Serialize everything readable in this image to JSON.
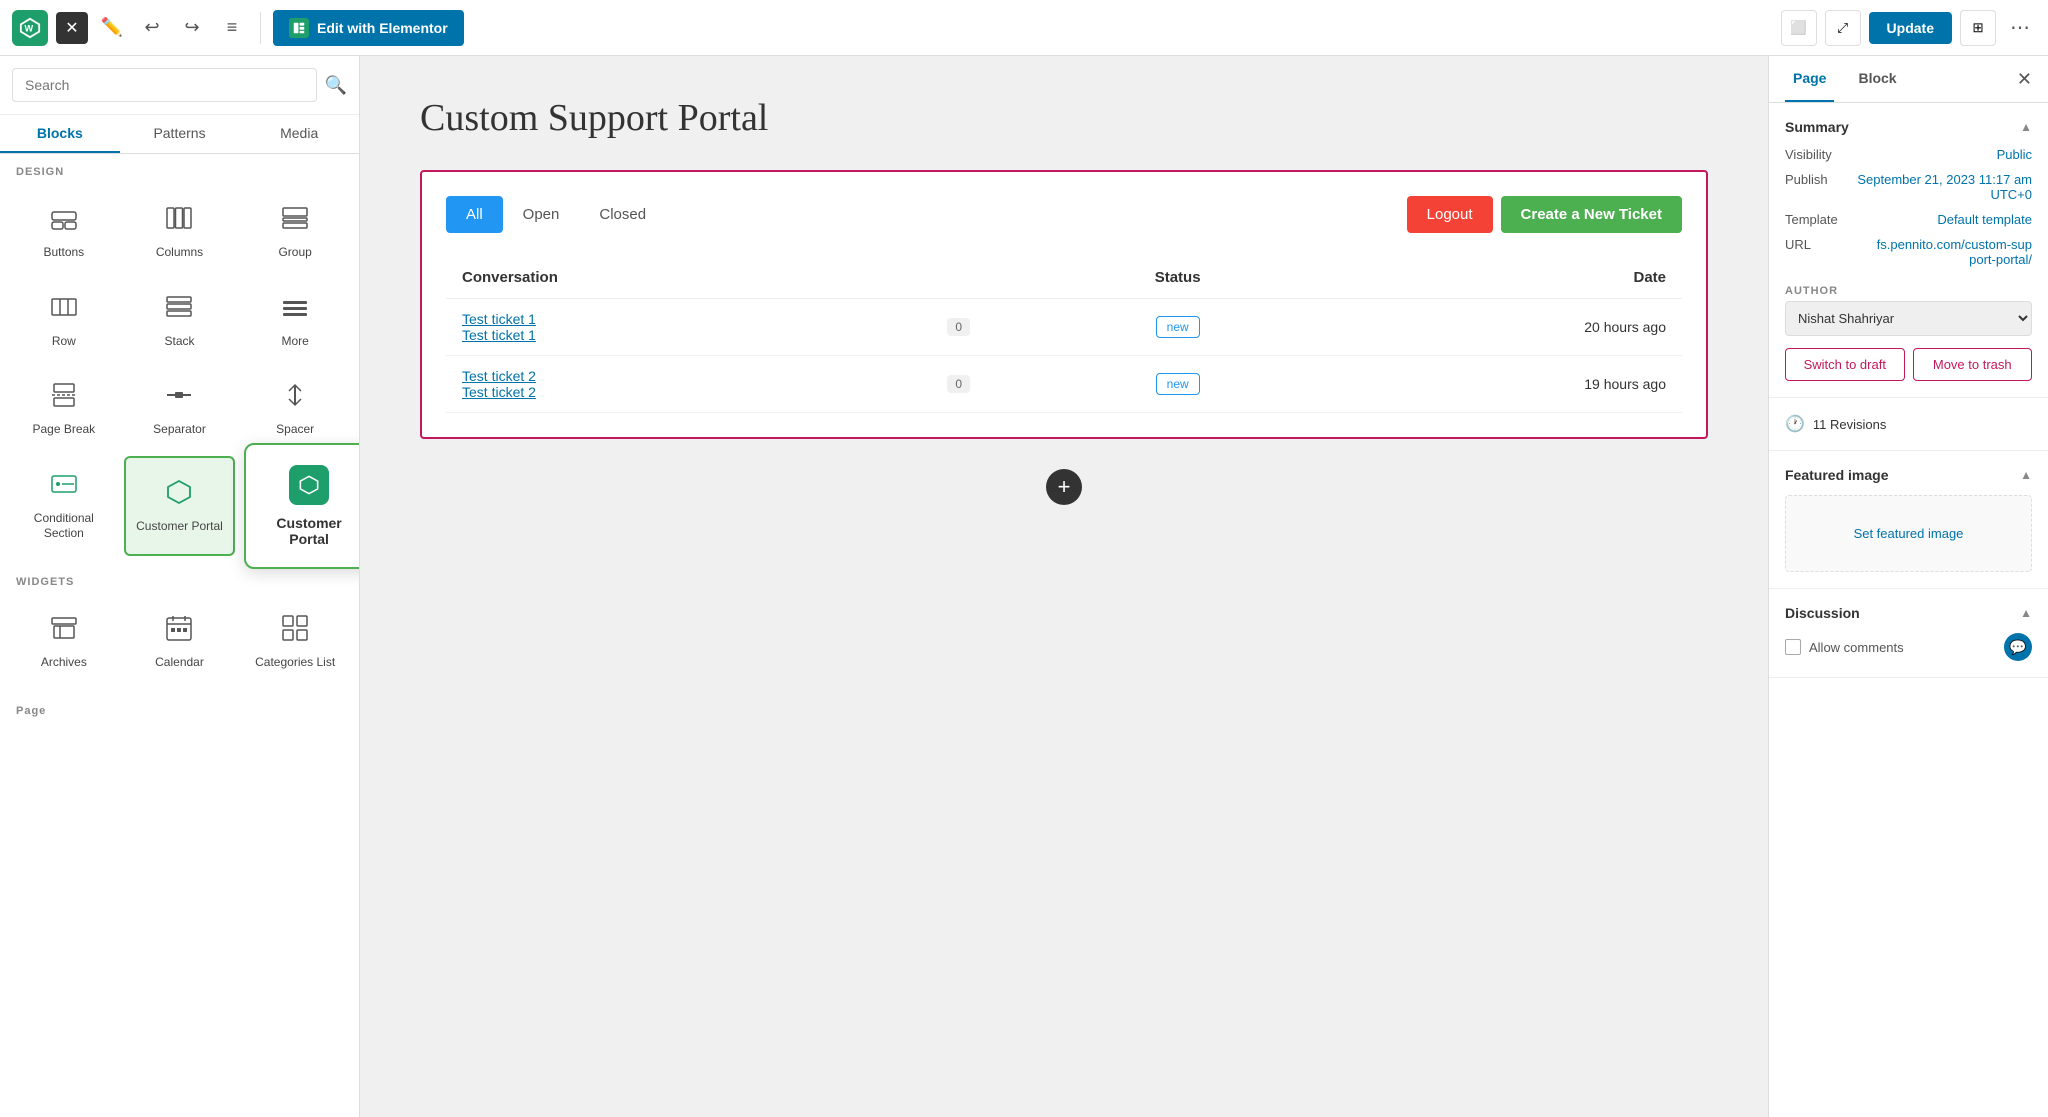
{
  "toolbar": {
    "edit_label": "Edit with Elementor",
    "update_label": "Update",
    "close_btn": "✕",
    "dots_label": "⋯"
  },
  "sidebar": {
    "search_placeholder": "Search",
    "tabs": [
      {
        "label": "Blocks",
        "active": true
      },
      {
        "label": "Patterns"
      },
      {
        "label": "Media"
      }
    ],
    "sections": [
      {
        "label": "DESIGN",
        "items": [
          {
            "icon": "⊞",
            "label": "Buttons"
          },
          {
            "icon": "⊟",
            "label": "Columns"
          },
          {
            "icon": "⊠",
            "label": "Group"
          },
          {
            "icon": "≡",
            "label": "Row"
          },
          {
            "icon": "⊡",
            "label": "Stack"
          },
          {
            "icon": "⋯",
            "label": "More"
          },
          {
            "icon": "⊟",
            "label": "Page Break"
          },
          {
            "icon": "—",
            "label": "Separator"
          },
          {
            "icon": "↗",
            "label": "Spacer"
          },
          {
            "icon": "⊞",
            "label": "Conditional Section",
            "highlighted": false
          },
          {
            "icon": "🟢",
            "label": "Customer Portal",
            "highlighted": true
          }
        ]
      },
      {
        "label": "WIDGETS",
        "items": [
          {
            "icon": "📁",
            "label": "Archives"
          },
          {
            "icon": "📅",
            "label": "Calendar"
          },
          {
            "icon": "⊞",
            "label": "Categories List"
          }
        ]
      }
    ],
    "page_label": "Page"
  },
  "canvas": {
    "page_title": "Custom Support Portal",
    "portal": {
      "tabs": [
        {
          "label": "All",
          "active": true
        },
        {
          "label": "Open"
        },
        {
          "label": "Closed"
        }
      ],
      "logout_label": "Logout",
      "new_ticket_label": "Create a New Ticket",
      "table": {
        "headers": [
          "Conversation",
          "",
          "Status",
          "Date"
        ],
        "rows": [
          {
            "link1": "Test ticket 1",
            "link2": "Test ticket 1",
            "count": "0",
            "status": "new",
            "date": "20 hours ago"
          },
          {
            "link1": "Test ticket 2",
            "link2": "Test ticket 2",
            "count": "0",
            "status": "new",
            "date": "19 hours ago"
          }
        ]
      }
    }
  },
  "right_panel": {
    "tabs": [
      {
        "label": "Page",
        "active": true
      },
      {
        "label": "Block"
      }
    ],
    "summary_label": "Summary",
    "visibility_label": "Visibility",
    "visibility_value": "Public",
    "publish_label": "Publish",
    "publish_value": "September 21, 2023 11:17 am UTC+0",
    "template_label": "Template",
    "template_value": "Default template",
    "url_label": "URL",
    "url_value": "fs.pennito.com/custom-support-portal/",
    "author_label": "AUTHOR",
    "author_value": "Nishat Shahriyar",
    "switch_draft_label": "Switch to draft",
    "move_trash_label": "Move to trash",
    "revisions_label": "11 Revisions",
    "featured_image_label": "Featured image",
    "set_featured_label": "Set featured image",
    "discussion_label": "Discussion",
    "allow_comments_label": "Allow comments"
  },
  "tooltip": {
    "label": "Customer Portal"
  }
}
